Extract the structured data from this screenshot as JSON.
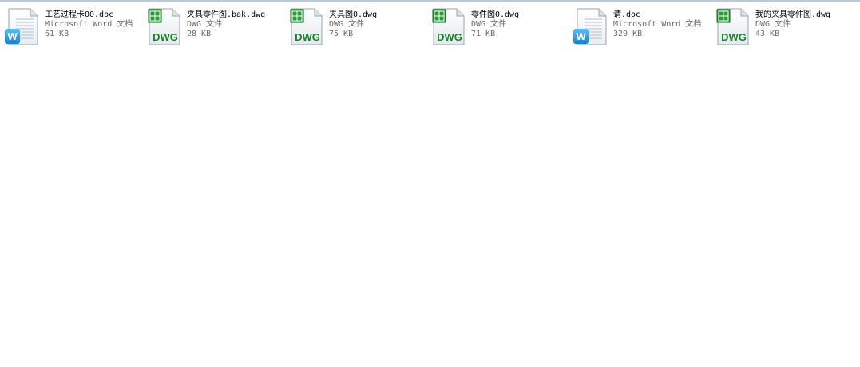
{
  "files": [
    {
      "name": "工艺过程卡00.doc",
      "type": "Microsoft Word 文档",
      "size": "61 KB",
      "icon": "word-doc-icon",
      "icon_letter": "W"
    },
    {
      "name": "夹具零件图.bak.dwg",
      "type": "DWG 文件",
      "size": "28 KB",
      "icon": "dwg-file-icon",
      "icon_label": "DWG"
    },
    {
      "name": "夹具图0.dwg",
      "type": "DWG 文件",
      "size": "75 KB",
      "icon": "dwg-file-icon",
      "icon_label": "DWG"
    },
    {
      "name": "零件图0.dwg",
      "type": "DWG 文件",
      "size": "71 KB",
      "icon": "dwg-file-icon",
      "icon_label": "DWG"
    },
    {
      "name": "请.doc",
      "type": "Microsoft Word 文档",
      "size": "329 KB",
      "icon": "word-doc-icon",
      "icon_letter": "W"
    },
    {
      "name": "我的夹具零件图.dwg",
      "type": "DWG 文件",
      "size": "43 KB",
      "icon": "dwg-file-icon",
      "icon_label": "DWG"
    }
  ],
  "colors": {
    "dwg_green": "#1e7f2e",
    "word_blue": "#2a8fd8",
    "secondary_text": "#6d6d6d"
  }
}
